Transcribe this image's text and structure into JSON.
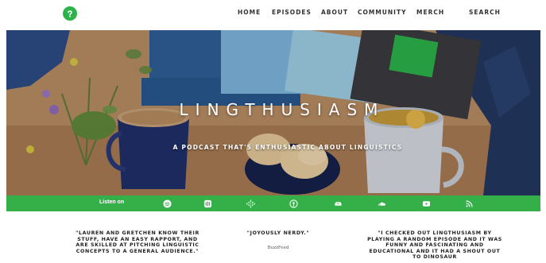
{
  "nav": {
    "logo_icon": "lingthusiasm-logo-icon",
    "items": [
      "HOME",
      "EPISODES",
      "ABOUT",
      "COMMUNITY",
      "MERCH"
    ],
    "search_label": "SEARCH"
  },
  "hero": {
    "title": "LINGTHUSIASM",
    "tagline": "A PODCAST THAT'S ENTHUSIASTIC ABOUT LINGUISTICS"
  },
  "listen": {
    "label": "Listen on",
    "platforms": [
      "spotify-icon",
      "stitcher-icon",
      "google-podcasts-icon",
      "podcast-icon",
      "amazon-music-icon",
      "soundcloud-icon",
      "youtube-icon",
      "rss-icon"
    ]
  },
  "quotes": [
    {
      "text": "\"LAUREN AND GRETCHEN KNOW THEIR STUFF, HAVE AN EASY RAPPORT, AND ARE SKILLED AT PITCHING LINGUISTIC CONCEPTS TO A GENERAL AUDIENCE.\"",
      "source": ""
    },
    {
      "text": "\"JOYOUSLY NERDY.\"",
      "source": "BuzzFeed"
    },
    {
      "text": "\"I CHECKED OUT LINGTHUSIASM BY PLAYING A RANDOM EPISODE AND IT WAS FUNNY AND FASCINATING AND EDUCATIONAL AND IT HAD A SHOUT OUT TO DINOSAUR",
      "source": ""
    }
  ],
  "colors": {
    "brand_green": "#35b049",
    "text_dark": "#222222"
  }
}
